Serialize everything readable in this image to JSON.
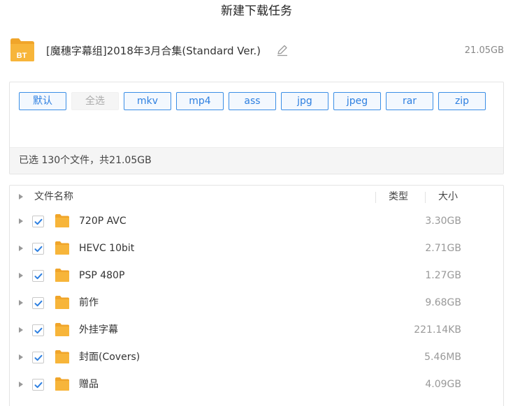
{
  "dialog": {
    "title": "新建下载任务"
  },
  "task": {
    "icon_label": "BT",
    "name": "[魔穗字幕组]2018年3月合集(Standard Ver.)",
    "total_size": "21.05GB"
  },
  "filters": [
    {
      "label": "默认",
      "state": "enabled"
    },
    {
      "label": "全选",
      "state": "disabled"
    },
    {
      "label": "mkv",
      "state": "enabled"
    },
    {
      "label": "mp4",
      "state": "enabled"
    },
    {
      "label": "ass",
      "state": "enabled"
    },
    {
      "label": "jpg",
      "state": "enabled"
    },
    {
      "label": "jpeg",
      "state": "enabled"
    },
    {
      "label": "rar",
      "state": "enabled"
    },
    {
      "label": "zip",
      "state": "enabled"
    }
  ],
  "summary": "已选 130个文件，共21.05GB",
  "list": {
    "headers": {
      "name": "文件名称",
      "type": "类型",
      "size": "大小"
    },
    "items": [
      {
        "name": "720P AVC",
        "size": "3.30GB",
        "checked": true
      },
      {
        "name": "HEVC 10bit",
        "size": "2.71GB",
        "checked": true
      },
      {
        "name": "PSP 480P",
        "size": "1.27GB",
        "checked": true
      },
      {
        "name": "前作",
        "size": "9.68GB",
        "checked": true
      },
      {
        "name": "外挂字幕",
        "size": "221.14KB",
        "checked": true
      },
      {
        "name": "封面(Covers)",
        "size": "5.46MB",
        "checked": true
      },
      {
        "name": "赠品",
        "size": "4.09GB",
        "checked": true
      }
    ]
  },
  "colors": {
    "accent": "#2d7fe0",
    "folder": "#f5b531",
    "check": "#2d7fe0"
  }
}
